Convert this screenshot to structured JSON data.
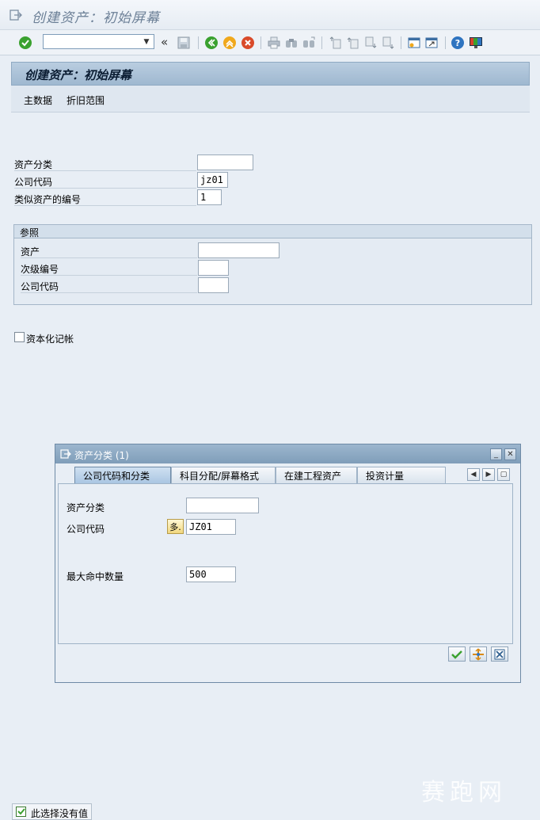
{
  "window": {
    "title": "创建资产：初始屏幕"
  },
  "toolbar": {
    "command_field_value": "",
    "back_chevron": "«"
  },
  "screen": {
    "header": "创建资产：初始屏幕",
    "app_buttons": [
      "主数据",
      "折旧范围"
    ]
  },
  "form": {
    "asset_class_label": "资产分类",
    "asset_class_value": "",
    "company_code_label": "公司代码",
    "company_code_value": "jz01",
    "similar_count_label": "类似资产的编号",
    "similar_count_value": "1"
  },
  "reference": {
    "title": "参照",
    "asset_label": "资产",
    "asset_value": "",
    "subnumber_label": "次级编号",
    "subnumber_value": "",
    "company_code_label": "公司代码",
    "company_code_value": ""
  },
  "capitalization": {
    "label": "资本化记帐",
    "checked": false
  },
  "dialog": {
    "title": "资产分类 (1)",
    "tabs": [
      "公司代码和分类",
      "科目分配/屏幕格式",
      "在建工程资产",
      "投资计量"
    ],
    "active_tab": 0,
    "asset_class_label": "资产分类",
    "asset_class_value": "",
    "company_code_label": "公司代码",
    "multi_select_label": "多.",
    "company_code_value": "JZ01",
    "max_hits_label": "最大命中数量",
    "max_hits_value": "500"
  },
  "status_bar": {
    "text": "此选择没有值"
  },
  "watermark": "赛跑网",
  "colors": {
    "header_bg": "#9fb8d0",
    "accent_green": "#3aa12f",
    "dialog_title_bg": "#7f9db9"
  }
}
